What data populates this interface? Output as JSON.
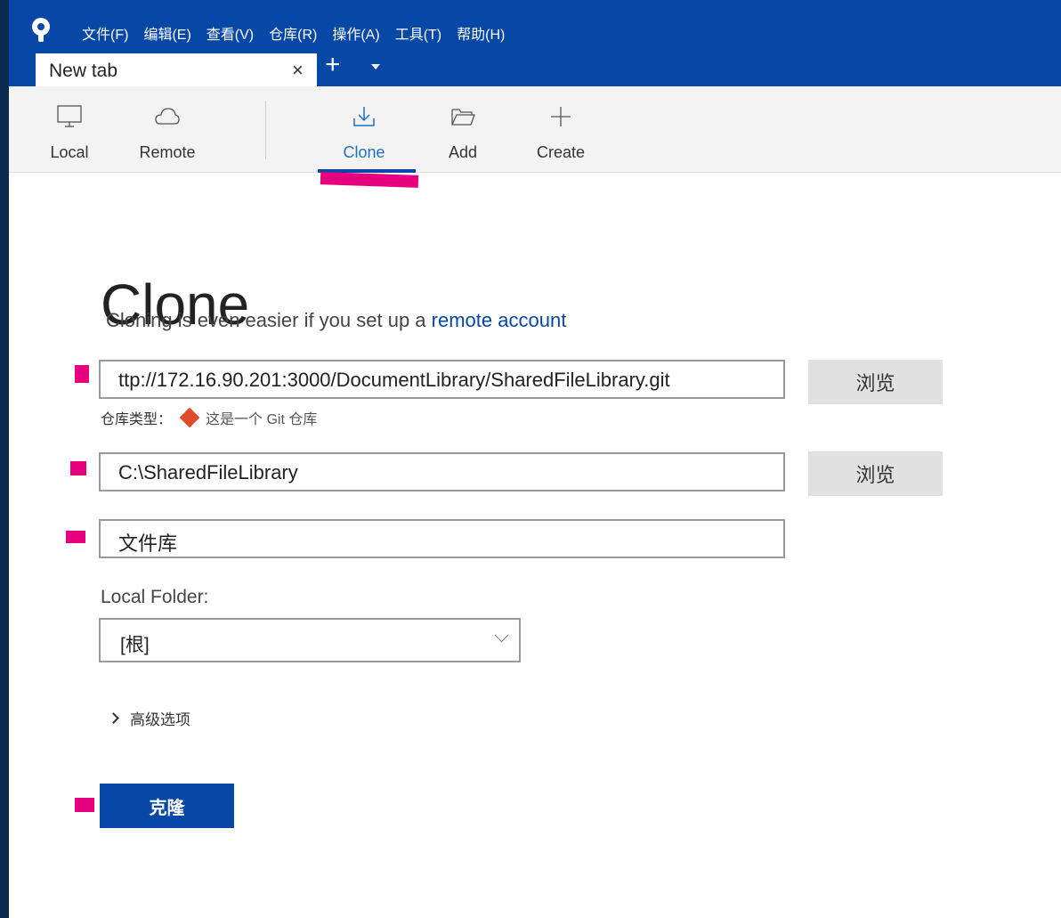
{
  "menu": [
    "文件(F)",
    "编辑(E)",
    "查看(V)",
    "仓库(R)",
    "操作(A)",
    "工具(T)",
    "帮助(H)"
  ],
  "tab": {
    "label": "New tab",
    "close": "×",
    "add": "+"
  },
  "toolbar": {
    "local": "Local",
    "remote": "Remote",
    "clone": "Clone",
    "add": "Add",
    "create": "Create",
    "active": "Clone"
  },
  "page": {
    "title": "Clone",
    "subtitle": "Cloning is even easier if you set up a",
    "subtitle_link": "remote account"
  },
  "form": {
    "source_url": "ttp://172.16.90.201:3000/DocumentLibrary/SharedFileLibrary.git",
    "repo_type_label": "仓库类型：",
    "repo_type_value": "这是一个 Git 仓库",
    "destination_path": "C:\\SharedFileLibrary",
    "name": "文件库",
    "browse_label": "浏览",
    "local_folder_label": "Local Folder:",
    "local_folder_value": "[根]",
    "advanced_label": "高级选项",
    "clone_button": "克隆"
  },
  "colors": {
    "title_bar": "#0747a6",
    "accent": "#0747a6",
    "annotation_marker": "#e6007e",
    "git_icon": "#e24a2c"
  }
}
